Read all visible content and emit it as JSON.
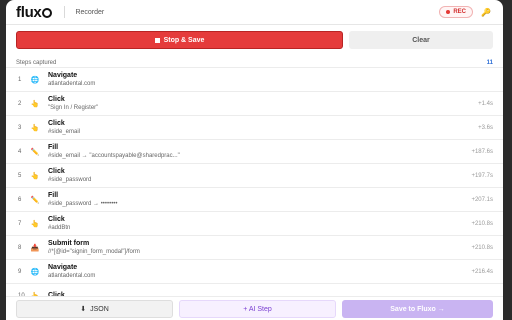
{
  "header": {
    "logo_text": "flux",
    "subtitle": "Recorder",
    "rec_label": "REC",
    "key_icon": "key-icon"
  },
  "actions": {
    "stop_label": "Stop & Save",
    "clear_label": "Clear"
  },
  "steps_header": {
    "label": "Steps captured",
    "count": "11"
  },
  "steps": [
    {
      "num": "1",
      "icon": "🌐",
      "type": "globe",
      "action": "Navigate",
      "detail": "atlantadental.com",
      "time": ""
    },
    {
      "num": "2",
      "icon": "👆",
      "type": "click",
      "action": "Click",
      "detail": "\"Sign In / Register\"",
      "time": "+1.4s"
    },
    {
      "num": "3",
      "icon": "👆",
      "type": "click",
      "action": "Click",
      "detail": "#side_email",
      "time": "+3.6s"
    },
    {
      "num": "4",
      "icon": "✏️",
      "type": "fill",
      "action": "Fill",
      "detail": "#side_email → \"accountspayable@sharedprac...\"",
      "time": "+187.6s"
    },
    {
      "num": "5",
      "icon": "👆",
      "type": "click",
      "action": "Click",
      "detail": "#side_password",
      "time": "+197.7s"
    },
    {
      "num": "6",
      "icon": "✏️",
      "type": "fill",
      "action": "Fill",
      "detail": "#side_password → ••••••••",
      "time": "+207.1s"
    },
    {
      "num": "7",
      "icon": "👆",
      "type": "click",
      "action": "Click",
      "detail": "#addBtn",
      "time": "+210.8s"
    },
    {
      "num": "8",
      "icon": "📥",
      "type": "submit",
      "action": "Submit form",
      "detail": "//*[@id=\"signin_form_modal\"]/form",
      "time": "+210.8s"
    },
    {
      "num": "9",
      "icon": "🌐",
      "type": "globe",
      "action": "Navigate",
      "detail": "atlantadental.com",
      "time": "+216.4s"
    },
    {
      "num": "10",
      "icon": "👆",
      "type": "click",
      "action": "Click",
      "detail": "",
      "time": ""
    }
  ],
  "footer": {
    "json_label": "JSON",
    "ai_label": "+ AI Step",
    "save_label": "Save to Fluxo →"
  },
  "colors": {
    "stop": "#e53b3b",
    "accent": "#2f6fd6",
    "save": "#c9b4f2",
    "rec": "#e53935"
  }
}
